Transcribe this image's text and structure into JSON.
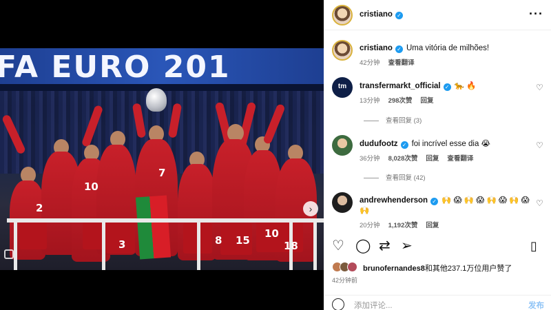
{
  "media": {
    "banner_text": "FA EURO 201",
    "jersey_numbers": [
      "2",
      "10",
      "7",
      "3",
      "8",
      "15",
      "10",
      "18"
    ],
    "next_icon": "chevron-right-icon"
  },
  "post": {
    "author": "cristiano",
    "more_icon": "more-horizontal-icon"
  },
  "caption": {
    "username": "cristiano",
    "text": "Uma vitória de milhões!",
    "time": "42分钟",
    "translate": "查看翻译"
  },
  "comments": [
    {
      "username": "transfermarkt_official",
      "text": "🐆 🔥",
      "time": "13分钟",
      "likes": "298次赞",
      "reply": "回复",
      "view_replies": "查看回复 (3)"
    },
    {
      "username": "dudufootz",
      "text": "foi incrível esse dia 😭",
      "time": "36分钟",
      "likes": "8,028次赞",
      "reply": "回复",
      "translate": "查看翻译",
      "view_replies": "查看回复 (42)"
    },
    {
      "username": "andrewhenderson",
      "text": "🙌 😱 🙌 😱 🙌 😱 🙌 😱 🙌",
      "time": "20分钟",
      "likes": "1,192次赞",
      "reply": "回复"
    }
  ],
  "likes": {
    "user": "brunofernandes8",
    "text": "和其他237.1万位用户赞了"
  },
  "time_ago": "42分钟前",
  "comment_box": {
    "placeholder": "添加评论...",
    "post": "发布"
  },
  "colors": {
    "verified": "#1d9bf0",
    "post_button": "#8ec3f6",
    "jersey": "#c8202a"
  }
}
